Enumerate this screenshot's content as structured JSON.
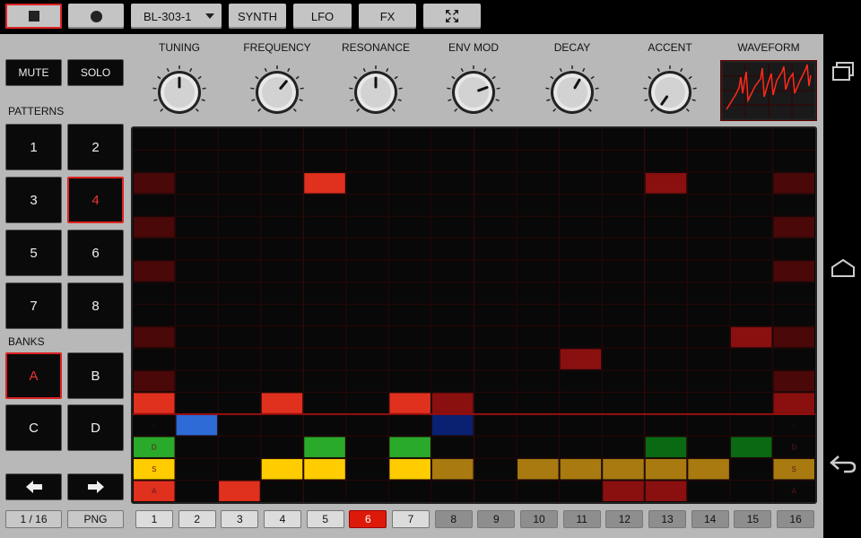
{
  "toolbar": {
    "stop_icon": "stop-icon",
    "record_icon": "record-icon",
    "preset": "BL-303-1",
    "synth": "SYNTH",
    "lfo": "LFO",
    "fx": "FX",
    "fullscreen_icon": "fullscreen-icon"
  },
  "controls": {
    "mute": "MUTE",
    "solo": "SOLO",
    "patterns_label": "PATTERNS",
    "patterns": [
      "1",
      "2",
      "3",
      "4",
      "5",
      "6",
      "7",
      "8"
    ],
    "selected_pattern": "4",
    "banks_label": "BANKS",
    "banks": [
      "A",
      "B",
      "C",
      "D"
    ],
    "selected_bank": "A",
    "page_indicator": "1 / 16",
    "png": "PNG"
  },
  "knobs": [
    {
      "label": "TUNING",
      "angle": 0
    },
    {
      "label": "FREQUENCY",
      "angle": 40
    },
    {
      "label": "RESONANCE",
      "angle": 0
    },
    {
      "label": "ENV MOD",
      "angle": 70
    },
    {
      "label": "DECAY",
      "angle": 30
    },
    {
      "label": "ACCENT",
      "angle": -145
    }
  ],
  "waveform_label": "WAVEFORM",
  "steps": [
    "1",
    "2",
    "3",
    "4",
    "5",
    "6",
    "7",
    "8",
    "9",
    "10",
    "11",
    "12",
    "13",
    "14",
    "15",
    "16"
  ],
  "current_step": "6",
  "colors": {
    "accent": "#dd2211",
    "bright_red": "#e0301e",
    "dark_red": "#8a1010",
    "dim_red": "#4a0808",
    "blue": "#2e6bd6",
    "dark_blue": "#0a2070",
    "green": "#2aaa2a",
    "dark_green": "#0a6a14",
    "yellow": "#ffcc00",
    "gold": "#a87a10"
  },
  "sequencer": {
    "columns": 16,
    "note_rows": 13,
    "param_rows": [
      "-",
      "D",
      "S",
      "A"
    ],
    "cells": [
      {
        "col": 0,
        "row": 2,
        "color": "dim_red"
      },
      {
        "col": 4,
        "row": 2,
        "color": "bright_red"
      },
      {
        "col": 12,
        "row": 2,
        "color": "dark_red"
      },
      {
        "col": 15,
        "row": 2,
        "color": "dim_red"
      },
      {
        "col": 0,
        "row": 4,
        "color": "dim_red"
      },
      {
        "col": 15,
        "row": 4,
        "color": "dim_red"
      },
      {
        "col": 0,
        "row": 6,
        "color": "dim_red"
      },
      {
        "col": 15,
        "row": 6,
        "color": "dim_red"
      },
      {
        "col": 0,
        "row": 9,
        "color": "dim_red"
      },
      {
        "col": 14,
        "row": 9,
        "color": "dark_red"
      },
      {
        "col": 15,
        "row": 9,
        "color": "dim_red"
      },
      {
        "col": 10,
        "row": 10,
        "color": "dark_red"
      },
      {
        "col": 0,
        "row": 11,
        "color": "dim_red"
      },
      {
        "col": 15,
        "row": 11,
        "color": "dim_red"
      },
      {
        "col": 0,
        "row": 12,
        "color": "bright_red"
      },
      {
        "col": 3,
        "row": 12,
        "color": "bright_red"
      },
      {
        "col": 6,
        "row": 12,
        "color": "bright_red"
      },
      {
        "col": 7,
        "row": 12,
        "color": "dark_red"
      },
      {
        "col": 15,
        "row": 12,
        "color": "dark_red"
      },
      {
        "col": 1,
        "row": 13,
        "color": "blue"
      },
      {
        "col": 7,
        "row": 13,
        "color": "dark_blue"
      },
      {
        "col": 0,
        "row": 14,
        "color": "green"
      },
      {
        "col": 4,
        "row": 14,
        "color": "green"
      },
      {
        "col": 6,
        "row": 14,
        "color": "green"
      },
      {
        "col": 12,
        "row": 14,
        "color": "dark_green"
      },
      {
        "col": 14,
        "row": 14,
        "color": "dark_green"
      },
      {
        "col": 0,
        "row": 15,
        "color": "yellow"
      },
      {
        "col": 3,
        "row": 15,
        "color": "yellow"
      },
      {
        "col": 4,
        "row": 15,
        "color": "yellow"
      },
      {
        "col": 6,
        "row": 15,
        "color": "yellow"
      },
      {
        "col": 7,
        "row": 15,
        "color": "gold"
      },
      {
        "col": 9,
        "row": 15,
        "color": "gold"
      },
      {
        "col": 10,
        "row": 15,
        "color": "gold"
      },
      {
        "col": 11,
        "row": 15,
        "color": "gold"
      },
      {
        "col": 12,
        "row": 15,
        "color": "gold"
      },
      {
        "col": 13,
        "row": 15,
        "color": "gold"
      },
      {
        "col": 15,
        "row": 15,
        "color": "gold"
      },
      {
        "col": 0,
        "row": 16,
        "color": "bright_red"
      },
      {
        "col": 2,
        "row": 16,
        "color": "bright_red"
      },
      {
        "col": 11,
        "row": 16,
        "color": "dark_red"
      },
      {
        "col": 12,
        "row": 16,
        "color": "dark_red"
      }
    ]
  },
  "navbar": {
    "recent_icon": "recent-apps-icon",
    "home_icon": "home-icon",
    "back_icon": "back-icon"
  }
}
